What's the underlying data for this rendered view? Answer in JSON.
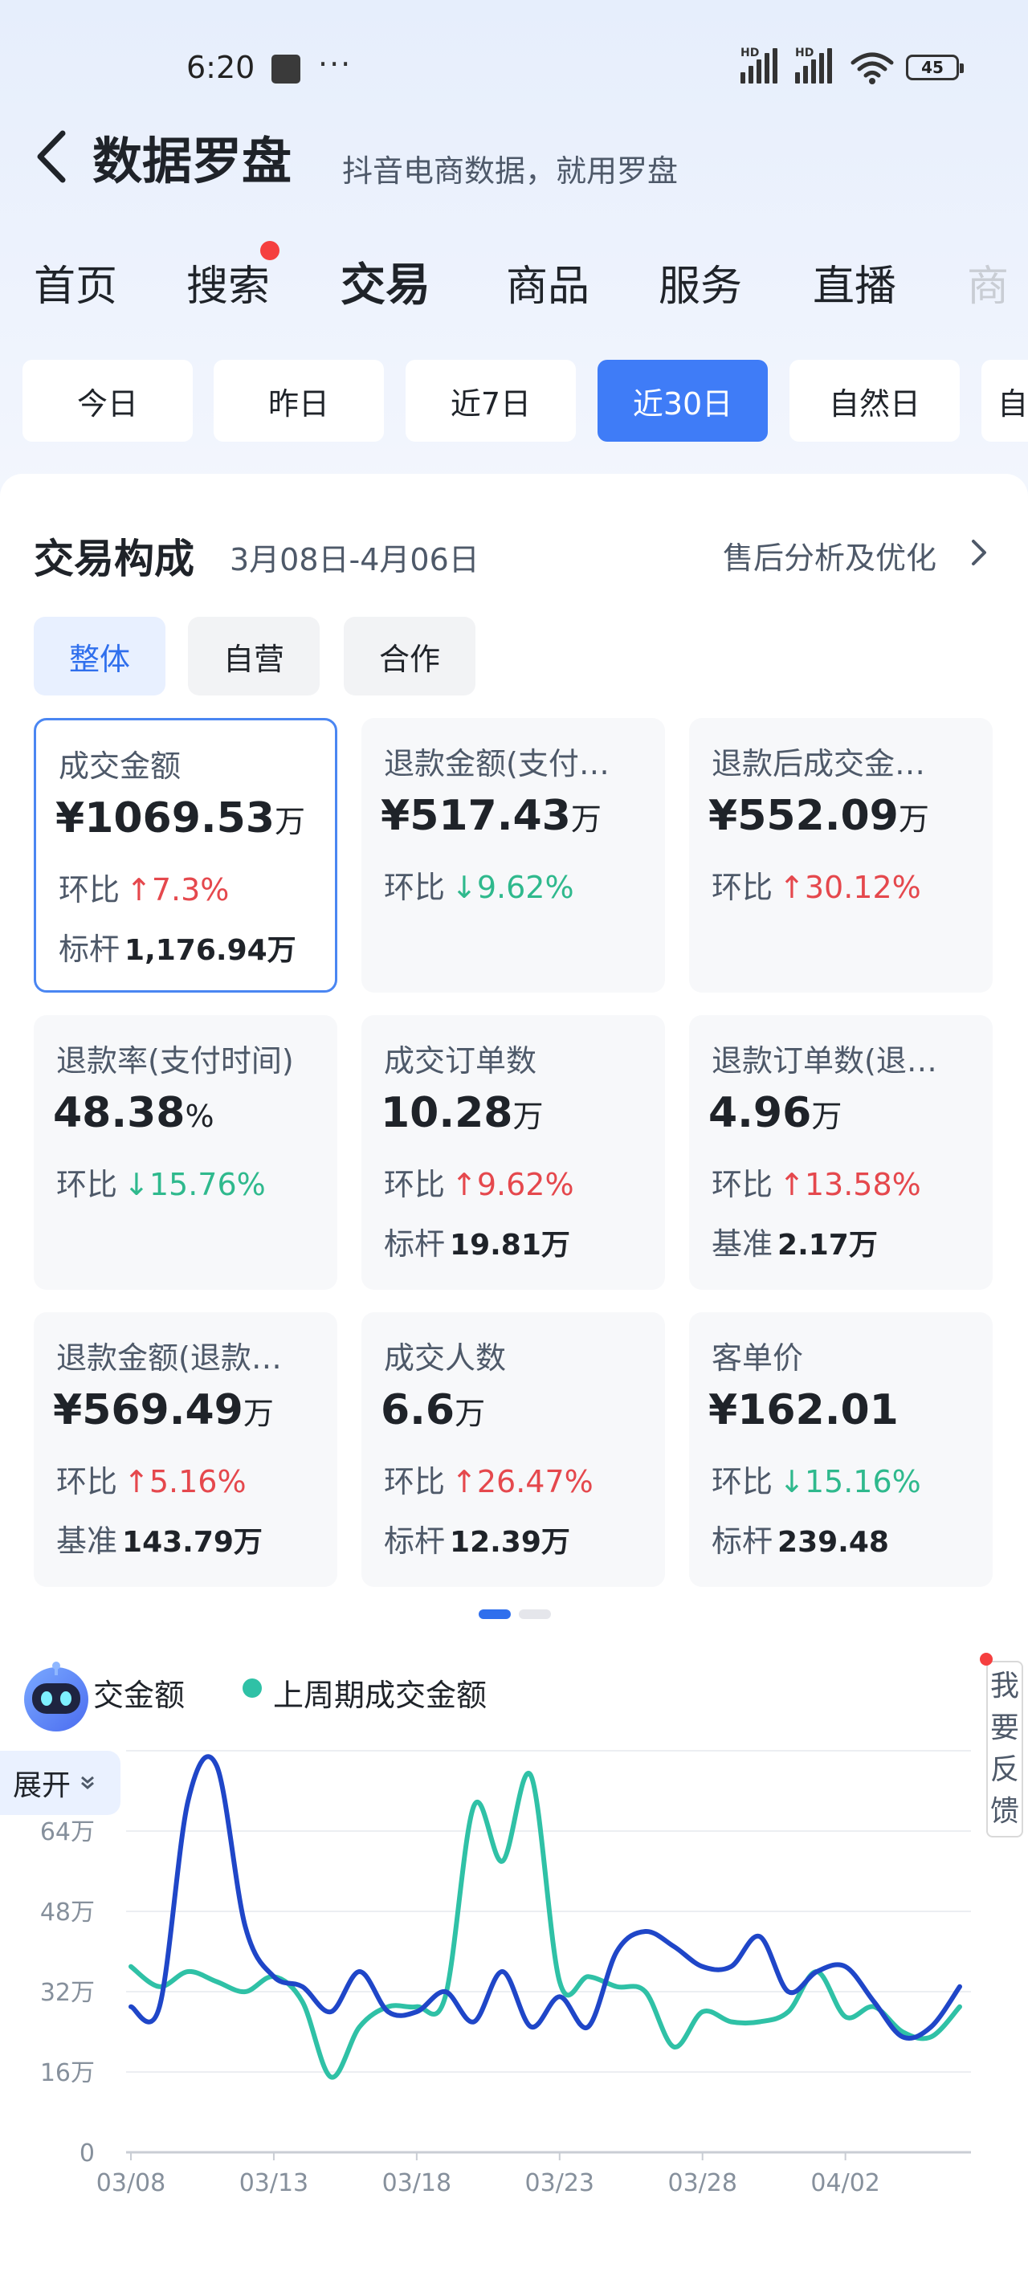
{
  "status_bar": {
    "time": "6:20",
    "dots": "···",
    "hd_label": "HD",
    "battery": "45"
  },
  "header": {
    "title": "数据罗盘",
    "subtitle": "抖音电商数据，就用罗盘"
  },
  "nav": {
    "tabs": [
      {
        "label": "首页",
        "active": false
      },
      {
        "label": "搜索",
        "active": false,
        "badge_dot": true
      },
      {
        "label": "交易",
        "active": true
      },
      {
        "label": "商品",
        "active": false
      },
      {
        "label": "服务",
        "active": false
      },
      {
        "label": "直播",
        "active": false
      },
      {
        "label": "商",
        "active": false
      }
    ]
  },
  "date_tabs": [
    {
      "label": "今日",
      "active": false
    },
    {
      "label": "昨日",
      "active": false
    },
    {
      "label": "近7日",
      "active": false
    },
    {
      "label": "近30日",
      "active": true
    },
    {
      "label": "自然日",
      "active": false
    },
    {
      "label": "自",
      "active": false
    }
  ],
  "section": {
    "title": "交易构成",
    "date_range": "3月08日-4月06日",
    "link": "售后分析及优化"
  },
  "segments": [
    {
      "label": "整体",
      "active": true
    },
    {
      "label": "自营",
      "active": false
    },
    {
      "label": "合作",
      "active": false
    }
  ],
  "metrics": [
    {
      "label": "成交金额",
      "prefix": "¥",
      "value": "1069.53",
      "unit": "万",
      "cmp_label": "环比",
      "dir": "up",
      "change": "7.3%",
      "bench_label": "标杆",
      "bench": "1,176.94万",
      "active": true
    },
    {
      "label": "退款金额(支付…",
      "prefix": "¥",
      "value": "517.43",
      "unit": "万",
      "cmp_label": "环比",
      "dir": "down",
      "change": "9.62%",
      "bench_label": "",
      "bench": ""
    },
    {
      "label": "退款后成交金…",
      "prefix": "¥",
      "value": "552.09",
      "unit": "万",
      "cmp_label": "环比",
      "dir": "up",
      "change": "30.12%",
      "bench_label": "",
      "bench": ""
    },
    {
      "label": "退款率(支付时间)",
      "prefix": "",
      "value": "48.38",
      "unit": "%",
      "cmp_label": "环比",
      "dir": "down",
      "change": "15.76%",
      "bench_label": "",
      "bench": ""
    },
    {
      "label": "成交订单数",
      "prefix": "",
      "value": "10.28",
      "unit": "万",
      "cmp_label": "环比",
      "dir": "up",
      "change": "9.62%",
      "bench_label": "标杆",
      "bench": "19.81万"
    },
    {
      "label": "退款订单数(退…",
      "prefix": "",
      "value": "4.96",
      "unit": "万",
      "cmp_label": "环比",
      "dir": "up",
      "change": "13.58%",
      "bench_label": "基准",
      "bench": "2.17万"
    },
    {
      "label": "退款金额(退款…",
      "prefix": "¥",
      "value": "569.49",
      "unit": "万",
      "cmp_label": "环比",
      "dir": "up",
      "change": "5.16%",
      "bench_label": "基准",
      "bench": "143.79万"
    },
    {
      "label": "成交人数",
      "prefix": "",
      "value": "6.6",
      "unit": "万",
      "cmp_label": "环比",
      "dir": "up",
      "change": "26.47%",
      "bench_label": "标杆",
      "bench": "12.39万"
    },
    {
      "label": "客单价",
      "prefix": "¥",
      "value": "162.01",
      "unit": "",
      "cmp_label": "环比",
      "dir": "down",
      "change": "15.16%",
      "bench_label": "标杆",
      "bench": "239.48"
    }
  ],
  "widgets": {
    "expand_label": "展开",
    "feedback_label": "我要反馈"
  },
  "colors": {
    "accent": "#3f7cf7",
    "up": "#e5484d",
    "down": "#2fb98d",
    "series_current": "#1f46c8",
    "series_previous": "#2fc1a6"
  },
  "chart_data": {
    "type": "line",
    "x_ticks": [
      "03/08",
      "03/13",
      "03/18",
      "03/23",
      "03/28",
      "04/02"
    ],
    "y_ticks": [
      "0",
      "16万",
      "32万",
      "48万",
      "64万"
    ],
    "ylim": [
      0,
      80
    ],
    "legend_visible": [
      "交金额",
      "上周期成交金额"
    ],
    "series": [
      {
        "name": "交金额",
        "color": "#1f46c8",
        "values": [
          29,
          29,
          70,
          77,
          45,
          35,
          33,
          28,
          36,
          28,
          28,
          32,
          26,
          36,
          25,
          31,
          25,
          40,
          44,
          41,
          37,
          37,
          43,
          32,
          36,
          37,
          30,
          23,
          25,
          33
        ]
      },
      {
        "name": "上周期成交金额",
        "color": "#2fc1a6",
        "values": [
          37,
          33,
          36,
          34,
          32,
          35,
          30,
          15,
          25,
          29,
          29,
          31,
          69,
          58,
          75,
          34,
          35,
          33,
          32,
          21,
          28,
          26,
          26,
          28,
          36,
          27,
          29,
          24,
          23,
          29
        ]
      }
    ],
    "grid": true
  }
}
